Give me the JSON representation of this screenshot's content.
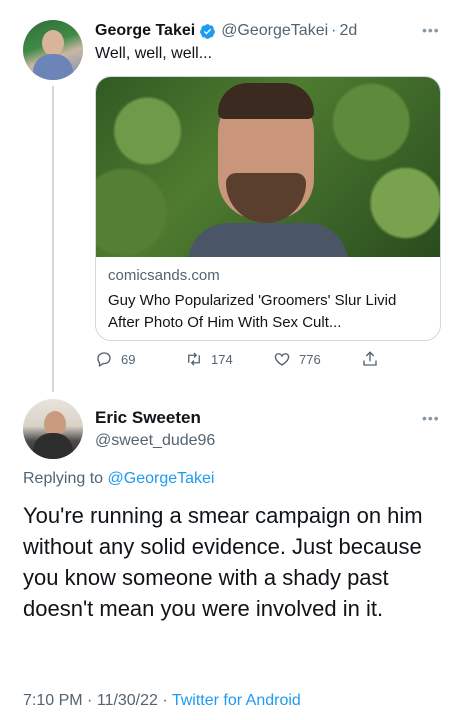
{
  "tweet1": {
    "display_name": "George Takei",
    "handle": "@GeorgeTakei",
    "separator": "·",
    "age": "2d",
    "text": "Well, well, well...",
    "card": {
      "domain": "comicsands.com",
      "title": "Guy Who Popularized 'Groomers' Slur Livid After Photo Of Him With Sex Cult..."
    },
    "actions": {
      "replies": "69",
      "retweets": "174",
      "likes": "776"
    }
  },
  "tweet2": {
    "display_name": "Eric Sweeten",
    "handle": "@sweet_dude96",
    "replying_prefix": "Replying to",
    "replying_to": "@GeorgeTakei",
    "text": "You're running a smear campaign on him without any solid evidence.  Just because you know someone with a shady past doesn't mean you were involved in it.",
    "time": "7:10 PM",
    "date": "11/30/22",
    "separator": "·",
    "source": "Twitter for Android"
  },
  "icons": {
    "verified": "verified-badge-icon",
    "more": "more-dots-icon",
    "reply": "reply-icon",
    "retweet": "retweet-icon",
    "like": "heart-icon",
    "share": "share-icon"
  },
  "colors": {
    "accent": "#1d9bf0",
    "text_primary": "#0f1419",
    "text_secondary": "#536471",
    "border": "#cfd9de"
  }
}
